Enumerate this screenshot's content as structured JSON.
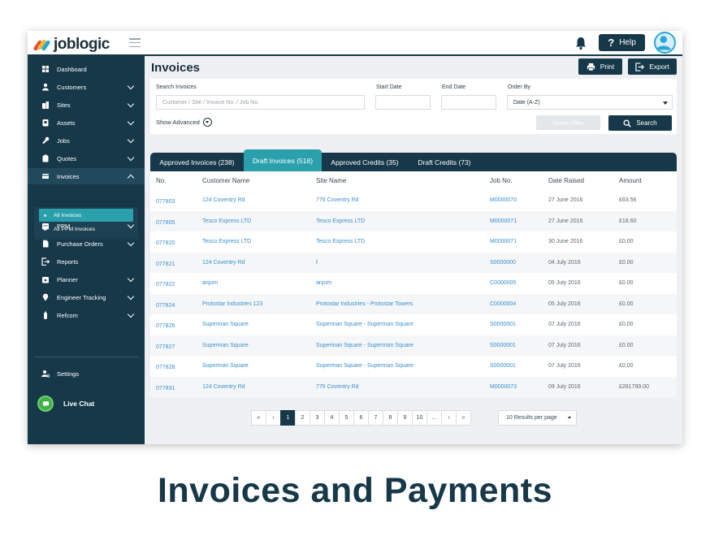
{
  "brand": {
    "name": "joblogic"
  },
  "header": {
    "help_label": "Help",
    "help_glyph": "?"
  },
  "sidebar": {
    "items": [
      {
        "label": "Dashboard",
        "icon": "dashboard-icon",
        "chevron": false
      },
      {
        "label": "Customers",
        "icon": "user-icon",
        "chevron": true
      },
      {
        "label": "Sites",
        "icon": "building-icon",
        "chevron": true
      },
      {
        "label": "Assets",
        "icon": "asset-icon",
        "chevron": true
      },
      {
        "label": "Jobs",
        "icon": "wrench-icon",
        "chevron": true
      },
      {
        "label": "Quotes",
        "icon": "clipboard-icon",
        "chevron": true
      },
      {
        "label": "Invoices",
        "icon": "invoice-icon",
        "chevron": true,
        "expanded": true
      },
      {
        "label": "PPM",
        "icon": "calendar-icon",
        "chevron": true
      },
      {
        "label": "Purchase Orders",
        "icon": "document-icon",
        "chevron": true
      },
      {
        "label": "Reports",
        "icon": "report-icon",
        "chevron": false
      },
      {
        "label": "Planner",
        "icon": "planner-icon",
        "chevron": true
      },
      {
        "label": "Engineer Tracking",
        "icon": "location-icon",
        "chevron": true
      },
      {
        "label": "Refcom",
        "icon": "cylinder-icon",
        "chevron": true
      }
    ],
    "subitems": [
      {
        "label": "All Invoices",
        "active": true
      },
      {
        "label": "All PPM Invoices",
        "active": false
      }
    ],
    "settings_label": "Settings",
    "live_chat_label": "Live Chat"
  },
  "main": {
    "title": "Invoices",
    "print_label": "Print",
    "export_label": "Export"
  },
  "filters": {
    "search_label": "Search Invoices",
    "search_placeholder": "Customer / Site / Invoice No. / Job No.",
    "start_date_label": "Start Date",
    "end_date_label": "End Date",
    "order_by_label": "Order By",
    "order_by_value": "Date (A-Z)",
    "show_advanced_label": "Show Advanced",
    "reset_label": "Reset Filter",
    "search_button_label": "Search"
  },
  "tabs": [
    {
      "label": "Approved Invoices (238)",
      "active": false
    },
    {
      "label": "Draft Invoices (518)",
      "active": true
    },
    {
      "label": "Approved Credits (35)",
      "active": false
    },
    {
      "label": "Draft Credits (73)",
      "active": false
    }
  ],
  "table": {
    "columns": [
      "No.",
      "Customer Name",
      "Site Name",
      "Job No.",
      "Date Raised",
      "Amount"
    ],
    "rows": [
      [
        "077803",
        "124 Coventry Rd",
        "776 Coventry Rd",
        "M0000070",
        "27 June 2016",
        "£63.56"
      ],
      [
        "077805",
        "Tesco Express LTD",
        "Tesco Express LTD",
        "M0000071",
        "27 June 2016",
        "£18.60"
      ],
      [
        "077820",
        "Tesco Express LTD",
        "Tesco Express LTD",
        "M0000071",
        "30 June 2016",
        "£0.00"
      ],
      [
        "077821",
        "124 Coventry Rd",
        "f",
        "S0000000",
        "04 July 2016",
        "£0.00"
      ],
      [
        "077822",
        "anjum",
        "anjum",
        "C0000005",
        "05 July 2016",
        "£0.00"
      ],
      [
        "077824",
        "Protostar Industries 123",
        "Protostar Industries - Protostar Towers",
        "C0000004",
        "05 July 2016",
        "£0.00"
      ],
      [
        "077826",
        "Superman Square",
        "Superman Square - Superman Square",
        "S0000001",
        "07 July 2016",
        "£0.00"
      ],
      [
        "077827",
        "Superman Square",
        "Superman Square - Superman Square",
        "S0000001",
        "07 July 2016",
        "£0.00"
      ],
      [
        "077828",
        "Superman Square",
        "Superman Square - Superman Square",
        "S0000001",
        "07 July 2016",
        "£0.00"
      ],
      [
        "077831",
        "124 Coventry Rd",
        "776 Coventry Rd",
        "M0000073",
        "09 July 2016",
        "£281799.00"
      ]
    ]
  },
  "pagination": {
    "pages": [
      "«",
      "‹",
      "1",
      "2",
      "3",
      "4",
      "5",
      "6",
      "7",
      "8",
      "9",
      "10",
      "...",
      "›",
      "»"
    ],
    "current": "1",
    "per_page": "10 Results per page"
  },
  "caption": "Invoices and Payments",
  "colors": {
    "navy": "#163848",
    "teal": "#2aa0ac",
    "link": "#3a8fd0",
    "chat_green": "#43b04a"
  }
}
